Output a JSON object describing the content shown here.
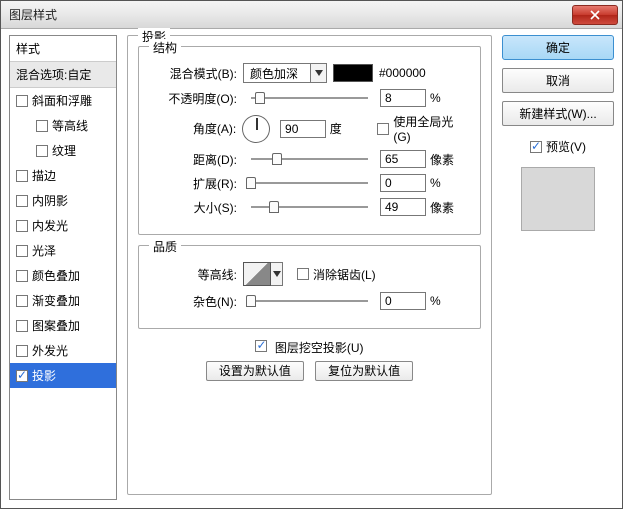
{
  "window": {
    "title": "图层样式"
  },
  "styles": {
    "header": "样式",
    "blending": "混合选项:自定",
    "items": [
      {
        "label": "斜面和浮雕",
        "checked": false,
        "indent": 0
      },
      {
        "label": "等高线",
        "checked": false,
        "indent": 1
      },
      {
        "label": "纹理",
        "checked": false,
        "indent": 1
      },
      {
        "label": "描边",
        "checked": false,
        "indent": 0
      },
      {
        "label": "内阴影",
        "checked": false,
        "indent": 0
      },
      {
        "label": "内发光",
        "checked": false,
        "indent": 0
      },
      {
        "label": "光泽",
        "checked": false,
        "indent": 0
      },
      {
        "label": "颜色叠加",
        "checked": false,
        "indent": 0
      },
      {
        "label": "渐变叠加",
        "checked": false,
        "indent": 0
      },
      {
        "label": "图案叠加",
        "checked": false,
        "indent": 0
      },
      {
        "label": "外发光",
        "checked": false,
        "indent": 0
      },
      {
        "label": "投影",
        "checked": true,
        "indent": 0,
        "selected": true
      }
    ]
  },
  "panel": {
    "title": "投影",
    "structure": {
      "legend": "结构",
      "blend_label": "混合模式(B):",
      "blend_value": "颜色加深",
      "color": "#000000",
      "opacity_label": "不透明度(O):",
      "opacity_value": "8",
      "opacity_unit": "%",
      "angle_label": "角度(A):",
      "angle_value": "90",
      "angle_unit": "度",
      "global_light": "使用全局光(G)",
      "global_light_checked": false,
      "distance_label": "距离(D):",
      "distance_value": "65",
      "px_unit": "像素",
      "spread_label": "扩展(R):",
      "spread_value": "0",
      "spread_unit": "%",
      "size_label": "大小(S):",
      "size_value": "49"
    },
    "quality": {
      "legend": "品质",
      "contour_label": "等高线:",
      "antialias": "消除锯齿(L)",
      "antialias_checked": false,
      "noise_label": "杂色(N):",
      "noise_value": "0",
      "noise_unit": "%"
    },
    "knockout": {
      "label": "图层挖空投影(U)",
      "checked": true
    },
    "defaults": {
      "set": "设置为默认值",
      "reset": "复位为默认值"
    }
  },
  "right": {
    "ok": "确定",
    "cancel": "取消",
    "new_style": "新建样式(W)...",
    "preview": "预览(V)",
    "preview_checked": true
  }
}
